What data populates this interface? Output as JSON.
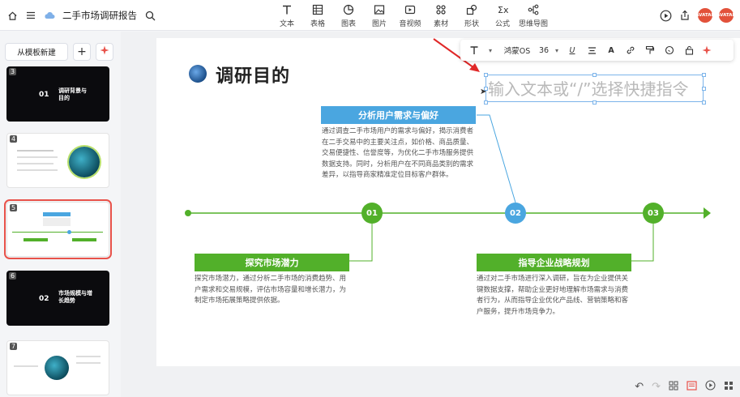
{
  "app": {
    "doc_title": "二手市场调研报告"
  },
  "toolbar": {
    "tools": [
      {
        "label": "文本",
        "icon": "text-icon"
      },
      {
        "label": "表格",
        "icon": "table-icon"
      },
      {
        "label": "图表",
        "icon": "chart-icon"
      },
      {
        "label": "图片",
        "icon": "image-icon"
      },
      {
        "label": "音视频",
        "icon": "media-icon"
      },
      {
        "label": "素材",
        "icon": "material-icon"
      },
      {
        "label": "形状",
        "icon": "shape-icon"
      },
      {
        "label": "公式",
        "icon": "formula-icon"
      },
      {
        "label": "思维导图",
        "icon": "mindmap-icon"
      }
    ],
    "avatar_label": "AVATAR"
  },
  "sidebar": {
    "template_button": "从模板新建",
    "thumbs": [
      {
        "num": "3",
        "text": "调研背景与目的",
        "index": "01"
      },
      {
        "num": "4",
        "text": ""
      },
      {
        "num": "5",
        "text": ""
      },
      {
        "num": "6",
        "text": "市场规模与增长趋势",
        "index": "02"
      },
      {
        "num": "7",
        "text": ""
      }
    ]
  },
  "format_bar": {
    "font": "鸿蒙OS",
    "size": "36"
  },
  "slide": {
    "title": "调研目的",
    "textbox_placeholder": "输入文本或“/”选择快捷指令",
    "nodes": [
      {
        "index": "01",
        "color": "#52b02a"
      },
      {
        "index": "02",
        "color": "#4aa6e0"
      },
      {
        "index": "03",
        "color": "#52b02a"
      }
    ],
    "sections": [
      {
        "heading": "分析用户需求与偏好",
        "color": "#4aa6e0",
        "body": "通过调查二手市场用户的需求与偏好，揭示消费者在二手交易中的主要关注点，如价格、商品质量、交易便捷性、信誉度等，为优化二手市场服务提供数据支持。同时，分析用户在不同商品类别的需求差异，以指导商家精准定位目标客户群体。"
      },
      {
        "heading": "探究市场潜力",
        "color": "#52b02a",
        "body": "探究市场潜力，通过分析二手市场的消费趋势、用户需求和交易规模，评估市场容量和增长潜力，为制定市场拓展策略提供依据。"
      },
      {
        "heading": "指导企业战略规划",
        "color": "#52b02a",
        "body": "通过对二手市场进行深入调研，旨在为企业提供关键数据支撑，帮助企业更好地理解市场需求与消费者行为，从而指导企业优化产品线、营销策略和客户服务，提升市场竞争力。"
      }
    ]
  }
}
